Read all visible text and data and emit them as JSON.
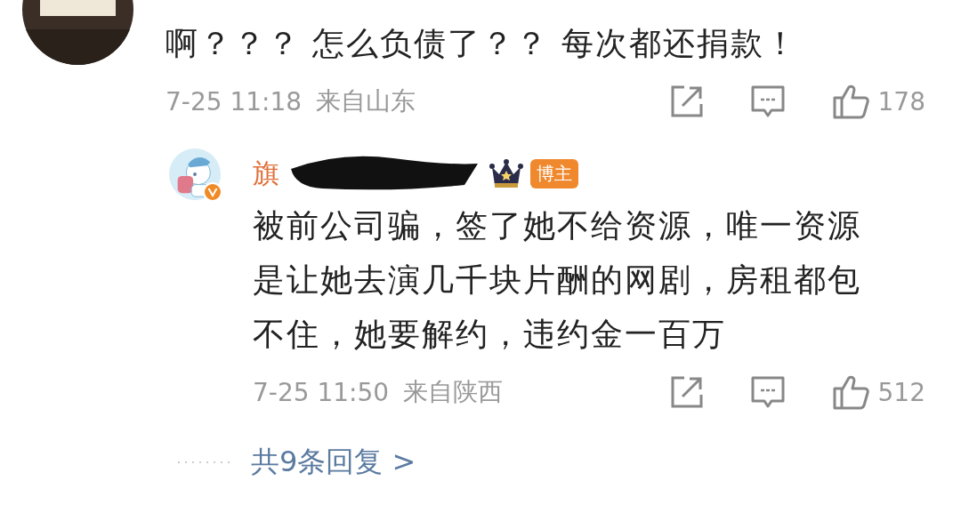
{
  "comments": [
    {
      "avatar": {
        "kind": "picture",
        "verified": false
      },
      "text": "啊？？？ 怎么负债了？？ 每次都还捐款！",
      "time": "7-25 11:18",
      "location": "来自山东",
      "likes": "178"
    },
    {
      "avatar": {
        "kind": "picture",
        "verified": true
      },
      "name": "旗",
      "badge": "博主",
      "text": "被前公司骗，签了她不给资源，唯一资源是让她去演几千块片酬的网剧，房租都包不住，她要解约，违约金一百万",
      "time": "7-25 11:50",
      "location": "来自陕西",
      "likes": "512"
    }
  ],
  "more_replies": "共9条回复 >"
}
